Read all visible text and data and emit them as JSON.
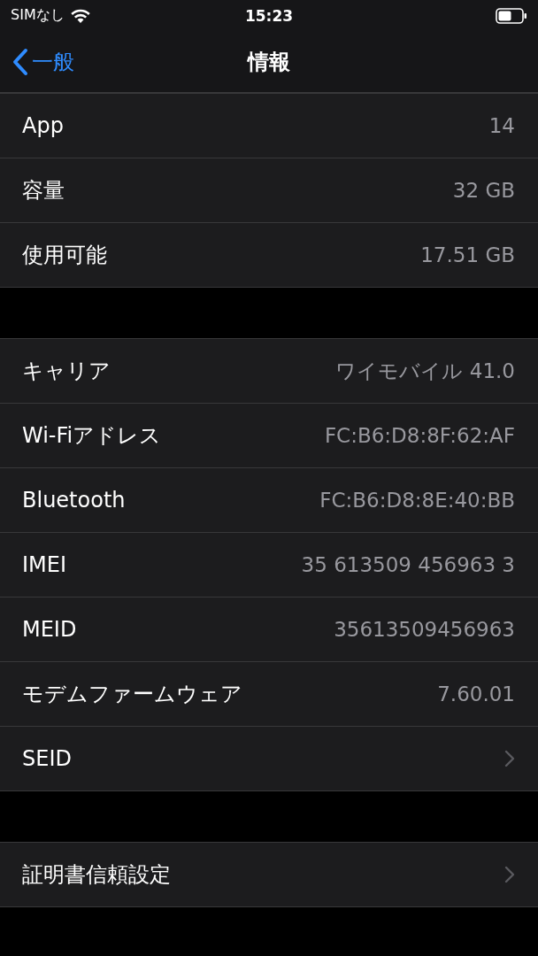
{
  "status_bar": {
    "carrier": "SIMなし",
    "time": "15:23"
  },
  "nav": {
    "back": "一般",
    "title": "情報"
  },
  "sections": [
    {
      "rows": [
        {
          "kind": "value",
          "label": "App",
          "value": "14"
        },
        {
          "kind": "value",
          "label": "容量",
          "value": "32 GB"
        },
        {
          "kind": "value",
          "label": "使用可能",
          "value": "17.51 GB"
        }
      ]
    },
    {
      "rows": [
        {
          "kind": "value",
          "label": "キャリア",
          "value": "ワイモバイル 41.0"
        },
        {
          "kind": "value",
          "label": "Wi-Fiアドレス",
          "value": "FC:B6:D8:8F:62:AF"
        },
        {
          "kind": "value",
          "label": "Bluetooth",
          "value": "FC:B6:D8:8E:40:BB"
        },
        {
          "kind": "value",
          "label": "IMEI",
          "value": "35 613509 456963 3"
        },
        {
          "kind": "value",
          "label": "MEID",
          "value": "35613509456963"
        },
        {
          "kind": "value",
          "label": "モデムファームウェア",
          "value": "7.60.01"
        },
        {
          "kind": "disclosure",
          "label": "SEID"
        }
      ]
    },
    {
      "rows": [
        {
          "kind": "disclosure",
          "label": "証明書信頼設定"
        }
      ]
    }
  ]
}
